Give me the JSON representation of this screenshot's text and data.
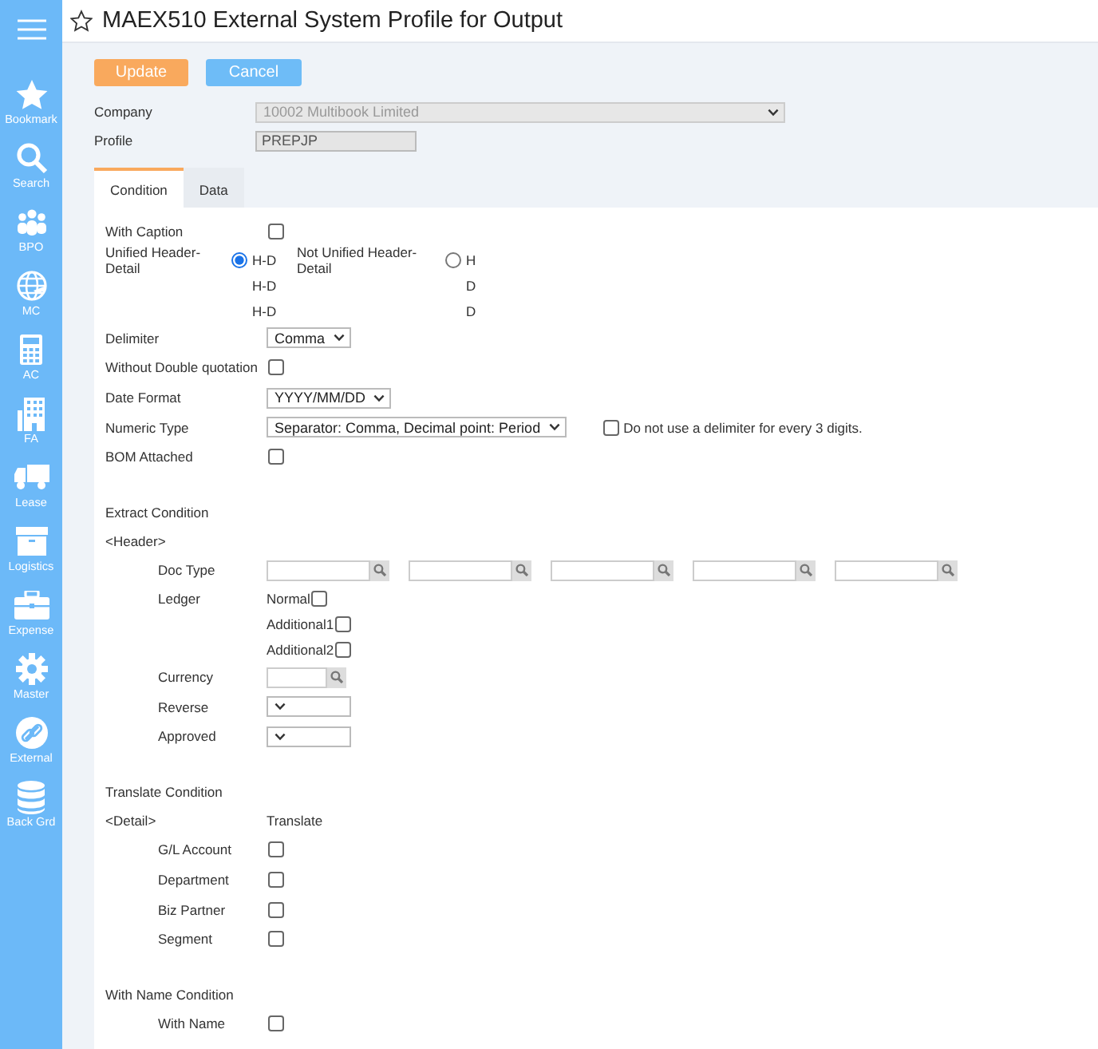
{
  "sidebar": {
    "items": [
      {
        "label": "Bookmark"
      },
      {
        "label": "Search"
      },
      {
        "label": "BPO"
      },
      {
        "label": "MC"
      },
      {
        "label": "AC"
      },
      {
        "label": "FA"
      },
      {
        "label": "Lease"
      },
      {
        "label": "Logistics"
      },
      {
        "label": "Expense"
      },
      {
        "label": "Master"
      },
      {
        "label": "External"
      },
      {
        "label": "Back Grd"
      }
    ]
  },
  "title": "MAEX510 External System Profile for Output",
  "buttons": [
    {
      "label": "Update",
      "kind": "primary"
    },
    {
      "label": "Cancel",
      "kind": "secondary"
    }
  ],
  "company": {
    "label": "Company",
    "value": "10002 Multibook Limited",
    "disabled": true
  },
  "profile": {
    "label": "Profile",
    "value": "PREPJP",
    "disabled": true
  },
  "tabs": [
    {
      "label": "Condition",
      "selected": true
    },
    {
      "label": "Data",
      "selected": false
    }
  ],
  "settings": [
    {
      "kind": "checkbox",
      "label": "With Caption",
      "checked": false
    },
    {
      "kind": "radio_group",
      "options": [
        {
          "label": "Unified Header-Detail",
          "selected": true,
          "lines": [
            "H-D",
            "H-D",
            "H-D"
          ]
        },
        {
          "label": "Not Unified Header-Detail",
          "selected": false,
          "lines": [
            "H",
            "D",
            "D"
          ]
        }
      ]
    },
    {
      "kind": "select",
      "label": "Delimiter",
      "value": "Comma"
    },
    {
      "kind": "checkbox",
      "label": "Without Double quotation",
      "checked": false
    },
    {
      "kind": "select",
      "label": "Date Format",
      "value": "YYYY/MM/DD"
    },
    {
      "kind": "select",
      "label": "Numeric Type",
      "value": "Separator: Comma, Decimal point: Period",
      "extra": {
        "label": "Do not use a delimiter for every 3 digits.",
        "checked": false
      }
    },
    {
      "kind": "checkbox",
      "label": "BOM Attached",
      "checked": false
    }
  ],
  "extract": {
    "title": "Extract Condition",
    "group": "<Header>",
    "rows": [
      {
        "kind": "lookups",
        "label": "Doc Type",
        "fields": [
          {
            "kind": "lookup"
          },
          {
            "kind": "lookup"
          },
          {
            "kind": "lookup"
          },
          {
            "kind": "lookup"
          },
          {
            "kind": "lookup"
          }
        ]
      },
      {
        "kind": "checklist",
        "label": "Ledger",
        "options": [
          {
            "label": "Normal",
            "checked": false
          },
          {
            "label": "Additional1",
            "checked": false
          },
          {
            "label": "Additional2",
            "checked": false
          }
        ]
      },
      {
        "kind": "lookup",
        "label": "Currency"
      },
      {
        "kind": "select",
        "label": "Reverse"
      },
      {
        "kind": "select",
        "label": "Approved"
      }
    ]
  },
  "translate": {
    "title": "Translate Condition",
    "group": "<Detail>",
    "column": "Translate",
    "rows": [
      {
        "label": "G/L Account",
        "checked": false
      },
      {
        "label": "Department",
        "checked": false
      },
      {
        "label": "Biz Partner",
        "checked": false
      },
      {
        "label": "Segment",
        "checked": false
      }
    ]
  },
  "with_name": {
    "title": "With Name Condition",
    "rows": [
      {
        "label": "With Name",
        "checked": false
      }
    ]
  }
}
